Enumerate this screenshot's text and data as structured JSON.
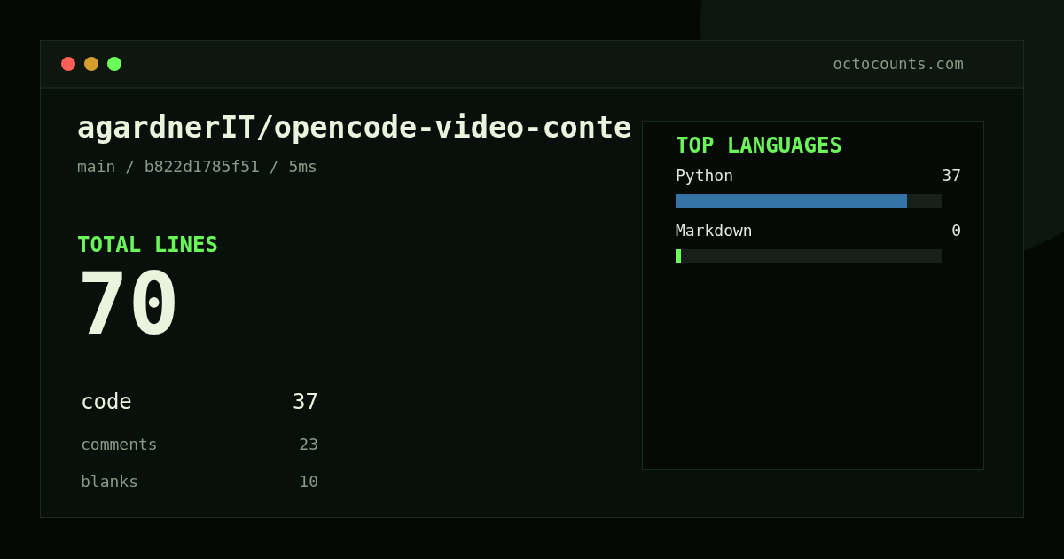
{
  "window": {
    "controls": [
      {
        "color": "#ff5f57"
      },
      {
        "color": "#d69e2e"
      },
      {
        "color": "#6cff5a"
      }
    ],
    "address": "octocounts.com"
  },
  "repo": {
    "title": "agardnerIT/opencode-video-conte",
    "meta": "main / b822d1785f51 / 5ms"
  },
  "total": {
    "label": "TOTAL LINES",
    "value": "70"
  },
  "stats": [
    {
      "kind": "primary",
      "label": "code",
      "value": "37"
    },
    {
      "kind": "secondary",
      "label": "comments",
      "value": "23"
    },
    {
      "kind": "secondary",
      "label": "blanks",
      "value": "10"
    }
  ],
  "languages": {
    "title": "TOP LANGUAGES",
    "items": [
      {
        "name": "Python",
        "count": "37",
        "level": 0.87,
        "color": "#3572a5"
      },
      {
        "name": "Markdown",
        "count": "0",
        "level": 0.02,
        "color": "#6cff5a"
      }
    ]
  }
}
